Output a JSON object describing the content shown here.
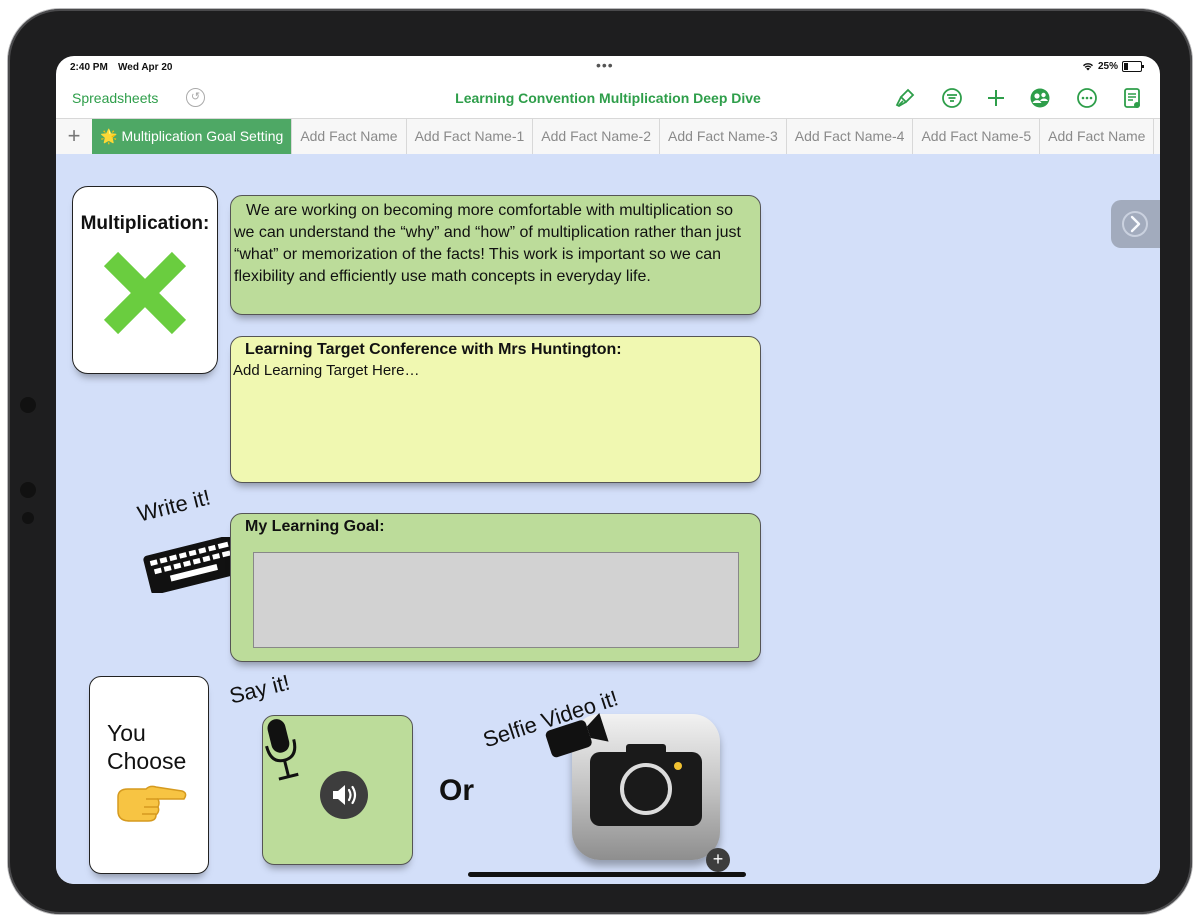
{
  "status_bar": {
    "time": "2:40 PM",
    "date": "Wed Apr 20",
    "battery": "25%",
    "multitask_dots": "•••"
  },
  "toolbar": {
    "back_label": "Spreadsheets",
    "title": "Learning Convention Multiplication  Deep Dive",
    "icons": [
      "undo-icon",
      "format-brush-icon",
      "filter-icon",
      "add-icon",
      "collaborate-icon",
      "more-icon",
      "document-icon"
    ],
    "accent": "#2e9e4a"
  },
  "tabs": {
    "add_glyph": "+",
    "star": "🌟",
    "items": [
      "Multiplication Goal Setting",
      "Add Fact Name",
      "Add Fact Name-1",
      "Add Fact Name-2",
      "Add Fact Name-3",
      "Add Fact Name-4",
      "Add Fact Name-5",
      "Add Fact Name"
    ],
    "active_index": 0,
    "active_color": "#4ea865"
  },
  "canvas": {
    "background": "#d3dff9",
    "multiplication_card": {
      "title": "Multiplication:"
    },
    "info_text": "We are working on becoming more comfortable with multiplication so we can understand the “why” and “how” of multiplication rather than just “what” or memorization of the facts!  This work is important so we can flexibility and efficiently use math concepts in everyday life.",
    "target": {
      "title": "Learning Target Conference with Mrs Huntington:",
      "placeholder": "Add Learning Target Here…"
    },
    "goal": {
      "title": "My Learning Goal:",
      "value": ""
    },
    "write_label": "Write it!",
    "choose_label": "You Choose",
    "say_label": "Say it!",
    "or_label": "Or",
    "selfie_label": "Selfie Video it!",
    "add_glyph": "+",
    "colors": {
      "green_box": "#bcdc9a",
      "yellow_box": "#f0f8b1",
      "input_gray": "#d2d2d2"
    }
  }
}
